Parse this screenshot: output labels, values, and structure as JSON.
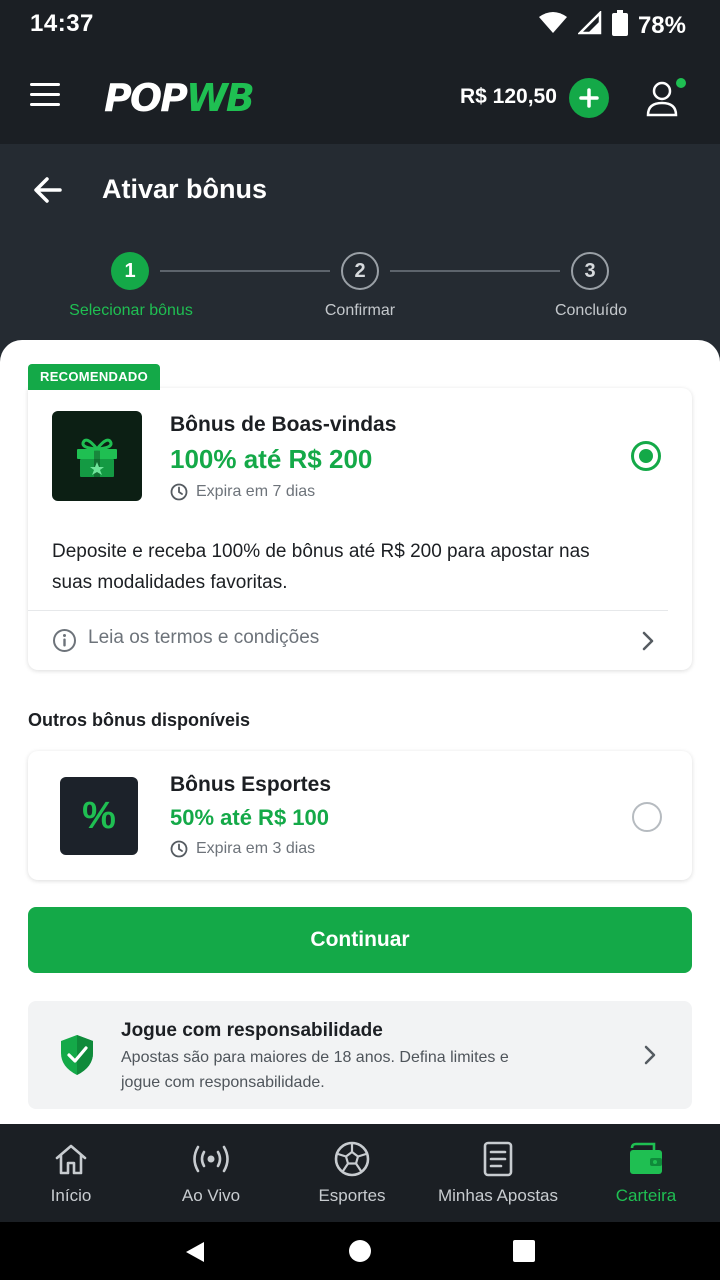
{
  "status_bar": {
    "time": "14:37",
    "battery": "78%"
  },
  "header": {
    "logo_main": "POP",
    "logo_accent": "WB",
    "balance": "R$ 120,50"
  },
  "page": {
    "title": "Ativar bônus"
  },
  "stepper": {
    "steps": [
      {
        "number": "1",
        "label": "Selecionar bônus"
      },
      {
        "number": "2",
        "label": "Confirmar"
      },
      {
        "number": "3",
        "label": "Concluído"
      }
    ]
  },
  "recommended": {
    "badge": "RECOMENDADO",
    "name": "Bônus de Boas-vindas",
    "amount": "100% até R$ 200",
    "expiry": "Expira em 7 dias",
    "description": "Deposite e receba 100% de bônus até R$ 200 para apostar nas suas modalidades favoritas.",
    "terms_link": "Leia os termos e condições"
  },
  "others": {
    "section_title": "Outros bônus disponíveis",
    "items": [
      {
        "icon": "%",
        "name": "Bônus Esportes",
        "amount": "50% até R$ 100",
        "expiry": "Expira em 3 dias"
      }
    ]
  },
  "continue_label": "Continuar",
  "responsible": {
    "title": "Jogue com responsabilidade",
    "text": "Apostas são para maiores de 18 anos. Defina limites e jogue com responsabilidade."
  },
  "bottom_nav": {
    "items": [
      {
        "label": "Início"
      },
      {
        "label": "Ao Vivo"
      },
      {
        "label": "Esportes"
      },
      {
        "label": "Minhas Apostas"
      },
      {
        "label": "Carteira"
      }
    ]
  },
  "colors": {
    "brand_green": "#14a948",
    "header_bg": "#1b1f24",
    "subheader_bg": "#252b32"
  }
}
